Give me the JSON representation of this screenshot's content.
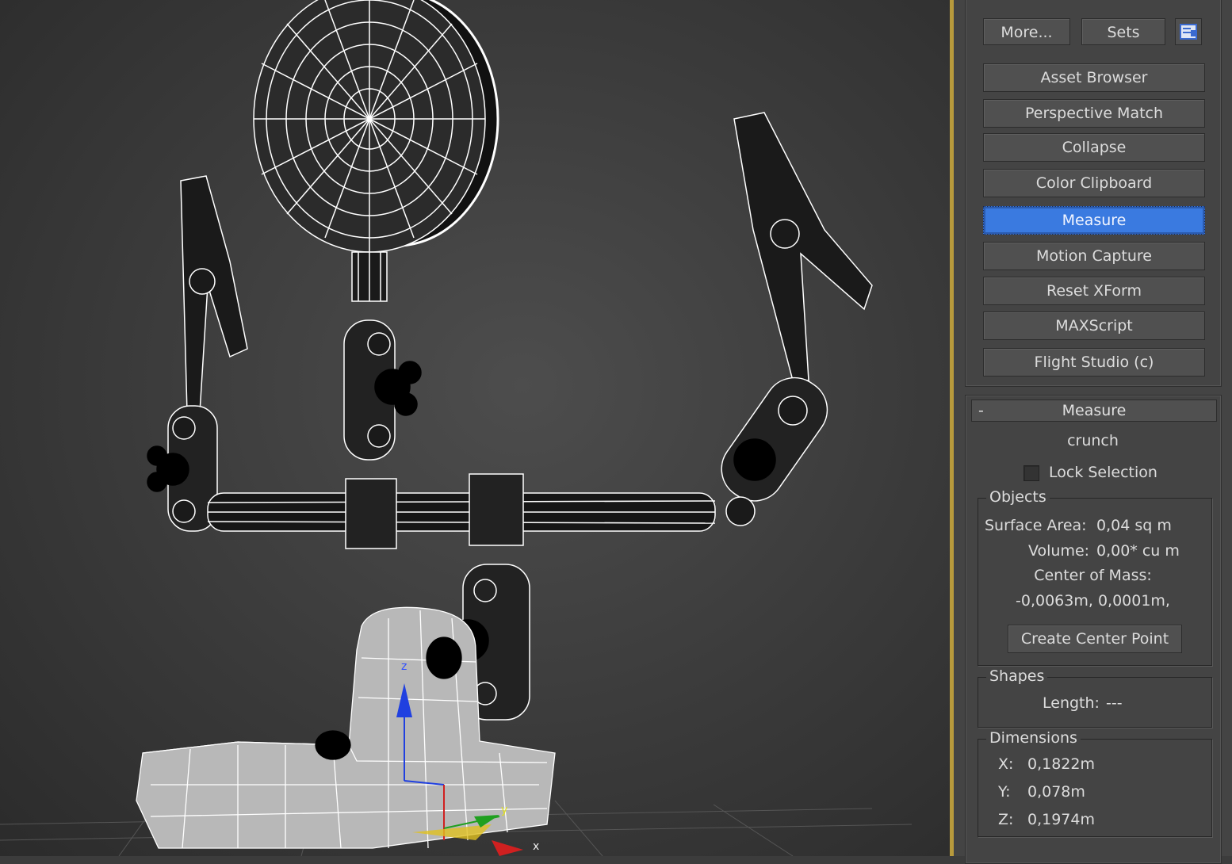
{
  "utilities": {
    "more_label": "More...",
    "sets_label": "Sets",
    "config_icon": "configure-button-sets-icon",
    "buttons": [
      {
        "label": "Asset Browser",
        "active": false
      },
      {
        "label": "Perspective Match",
        "active": false
      },
      {
        "label": "Collapse",
        "active": false
      },
      {
        "label": "Color Clipboard",
        "active": false
      },
      {
        "label": "Measure",
        "active": true
      },
      {
        "label": "Motion Capture",
        "active": false
      },
      {
        "label": "Reset XForm",
        "active": false
      },
      {
        "label": "MAXScript",
        "active": false
      },
      {
        "label": "Flight Studio (c)",
        "active": false
      }
    ]
  },
  "measure": {
    "rollout_toggle": "-",
    "title": "Measure",
    "object_name": "crunch",
    "lock_selection_label": "Lock Selection",
    "lock_selection_checked": false,
    "objects": {
      "title": "Objects",
      "surface_area_label": "Surface Area:",
      "surface_area_value": "0,04 sq m",
      "volume_label": "Volume:",
      "volume_value": "0,00* cu m",
      "center_of_mass_label": "Center of Mass:",
      "center_of_mass_value": "-0,0063m, 0,0001m,",
      "create_center_point_label": "Create Center Point"
    },
    "shapes": {
      "title": "Shapes",
      "length_label": "Length:",
      "length_value": "---"
    },
    "dimensions": {
      "title": "Dimensions",
      "x_label": "X:",
      "x_value": "0,1822m",
      "y_label": "Y:",
      "y_value": "0,078m",
      "z_label": "Z:",
      "z_value": "0,1974m"
    }
  },
  "gizmo": {
    "x_label": "x",
    "y_label": "y",
    "z_label": "z"
  },
  "colors": {
    "viewport_bg": "#3c3c3c",
    "viewport_border": "#b89a3c",
    "panel_bg": "#444444",
    "active_button": "#3a7ae0",
    "axis_x": "#d02020",
    "axis_y": "#20a020",
    "axis_z": "#2040e0"
  }
}
